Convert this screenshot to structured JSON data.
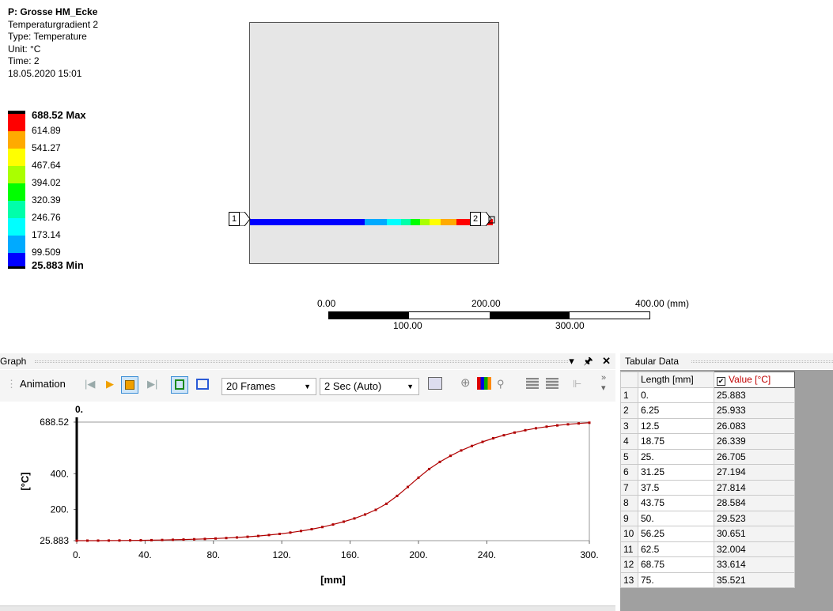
{
  "legend": {
    "title": "P: Grosse HM_Ecke",
    "lines": [
      "Temperaturgradient 2",
      "Type: Temperature",
      "Unit: °C",
      "Time: 2",
      "18.05.2020 15:01"
    ],
    "max_label": "688.52 Max",
    "min_label": "25.883 Min",
    "mid_labels": [
      "614.89",
      "541.27",
      "467.64",
      "394.02",
      "320.39",
      "246.76",
      "173.14",
      "99.509"
    ],
    "colors": [
      "#ff0000",
      "#ffaa00",
      "#ffff00",
      "#aaff00",
      "#00ff00",
      "#00ffaa",
      "#00ffff",
      "#00aaff",
      "#0000ff"
    ]
  },
  "viewport": {
    "probe_start": "1",
    "probe_end": "2",
    "scale_top": [
      "0.00",
      "200.00",
      "400.00 (mm)"
    ],
    "scale_bottom": [
      "100.00",
      "300.00"
    ]
  },
  "graph_panel": {
    "title": "Graph",
    "pin_icon": "pin-icon",
    "close_icon": "close-icon",
    "animation_label": "Animation",
    "frames": "20 Frames",
    "duration": "2 Sec (Auto)"
  },
  "tabular_panel": {
    "title": "Tabular Data",
    "col_length": "Length [mm]",
    "col_value": "Value [°C]",
    "rows": [
      [
        "1",
        "0.",
        "25.883"
      ],
      [
        "2",
        "6.25",
        "25.933"
      ],
      [
        "3",
        "12.5",
        "26.083"
      ],
      [
        "4",
        "18.75",
        "26.339"
      ],
      [
        "5",
        "25.",
        "26.705"
      ],
      [
        "6",
        "31.25",
        "27.194"
      ],
      [
        "7",
        "37.5",
        "27.814"
      ],
      [
        "8",
        "43.75",
        "28.584"
      ],
      [
        "9",
        "50.",
        "29.523"
      ],
      [
        "10",
        "56.25",
        "30.651"
      ],
      [
        "11",
        "62.5",
        "32.004"
      ],
      [
        "12",
        "68.75",
        "33.614"
      ],
      [
        "13",
        "75.",
        "35.521"
      ]
    ]
  },
  "chart_data": {
    "type": "line",
    "title": "",
    "xlabel": "[mm]",
    "ylabel": "[°C]",
    "cursor_label": "0.",
    "xlim": [
      0,
      300
    ],
    "ylim": [
      25.883,
      688.52
    ],
    "x_ticks": [
      "0.",
      "40.",
      "80.",
      "120.",
      "160.",
      "200.",
      "240.",
      "300."
    ],
    "x_tick_values": [
      0,
      40,
      80,
      120,
      160,
      200,
      240,
      300
    ],
    "y_ticks": [
      "25.883",
      "200.",
      "400.",
      "688.52"
    ],
    "y_tick_values": [
      25.883,
      200,
      400,
      688.52
    ],
    "grid": false,
    "line_color": "#b00000",
    "x": [
      0,
      6.25,
      12.5,
      18.75,
      25,
      31.25,
      37.5,
      43.75,
      50,
      56.25,
      62.5,
      68.75,
      75,
      81.25,
      87.5,
      93.75,
      100,
      106.25,
      112.5,
      118.75,
      125,
      131.25,
      137.5,
      143.75,
      150,
      156.25,
      162.5,
      168.75,
      175,
      181.25,
      187.5,
      193.75,
      200,
      206.25,
      212.5,
      218.75,
      225,
      231.25,
      237.5,
      243.75,
      250,
      256.25,
      262.5,
      268.75,
      275,
      281.25,
      287.5,
      293.75,
      300
    ],
    "values": [
      25.883,
      25.933,
      26.083,
      26.339,
      26.705,
      27.194,
      27.814,
      28.584,
      29.523,
      30.651,
      32.004,
      33.614,
      35.521,
      37.8,
      40.5,
      43.7,
      47.5,
      52,
      57.3,
      63.6,
      71,
      79.8,
      90,
      102,
      116,
      132,
      150,
      172,
      198,
      232,
      276,
      326,
      378,
      426,
      466,
      500,
      530,
      555,
      578,
      598,
      615,
      630,
      643,
      654,
      663,
      670,
      676,
      681,
      685
    ]
  }
}
